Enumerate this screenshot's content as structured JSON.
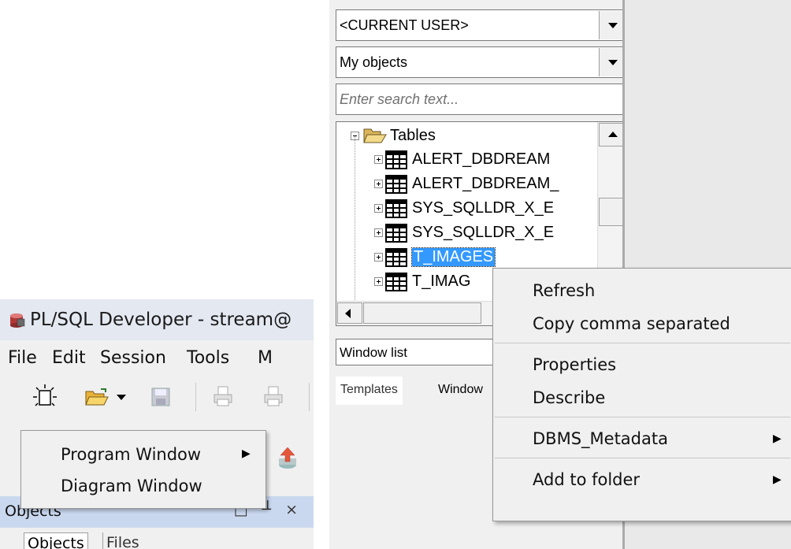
{
  "app": {
    "title": "PL/SQL Developer - stream@",
    "menu": [
      "File",
      "Edit",
      "Session",
      "Tools",
      "M"
    ],
    "new_menu": {
      "items": [
        {
          "label": "Program Window",
          "submenu": true
        },
        {
          "label": "Diagram Window",
          "submenu": false
        }
      ]
    },
    "objects_panel": {
      "title": "Objects",
      "header_buttons": "□ ╨ ×",
      "tabs": [
        "Objects",
        "Files"
      ]
    }
  },
  "browser": {
    "user_combo": "<CURRENT USER>",
    "filter_combo": "My objects",
    "search_placeholder": "Enter search text...",
    "tree": {
      "root": "Tables",
      "children": [
        {
          "label": "ALERT_DBDREAM",
          "selected": false
        },
        {
          "label": "ALERT_DBDREAM_",
          "selected": false
        },
        {
          "label": "SYS_SQLLDR_X_E",
          "selected": false
        },
        {
          "label": "SYS_SQLLDR_X_E",
          "selected": false
        },
        {
          "label": "T_IMAGES",
          "selected": true
        },
        {
          "label": "T_IMAG",
          "selected": false
        }
      ]
    },
    "window_list": "Window list",
    "bottom_tabs": [
      "Templates",
      "Window"
    ]
  },
  "context_menu": {
    "groups": [
      [
        {
          "label": "Refresh",
          "submenu": false
        },
        {
          "label": "Copy comma separated",
          "submenu": false
        }
      ],
      [
        {
          "label": "Properties",
          "submenu": false
        },
        {
          "label": "Describe",
          "submenu": false
        }
      ],
      [
        {
          "label": "DBMS_Metadata",
          "submenu": true
        }
      ],
      [
        {
          "label": "Add to folder",
          "submenu": true
        }
      ]
    ]
  },
  "colors": {
    "selection": "#3399ff",
    "menu_bg": "#f0f0f0",
    "panel_header": "#cad8ef"
  }
}
